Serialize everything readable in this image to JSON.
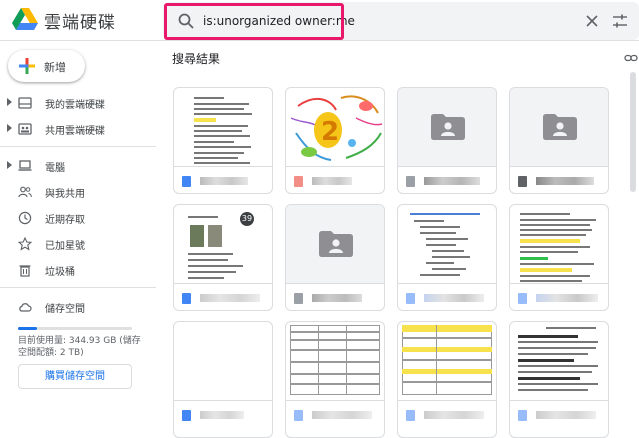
{
  "header": {
    "app_title": "雲端硬碟",
    "search_value": "is:unorganized owner:me",
    "highlight_color": "#e8196b"
  },
  "sidebar": {
    "new_label": "新增",
    "items": [
      {
        "label": "我的雲端硬碟",
        "icon": "drive-icon",
        "expandable": true
      },
      {
        "label": "共用雲端硬碟",
        "icon": "shared-drive-icon",
        "expandable": true
      },
      {
        "label": "電腦",
        "icon": "computer-icon",
        "expandable": true
      },
      {
        "label": "與我共用",
        "icon": "people-icon",
        "expandable": false
      },
      {
        "label": "近期存取",
        "icon": "clock-icon",
        "expandable": false
      },
      {
        "label": "已加星號",
        "icon": "star-icon",
        "expandable": false
      },
      {
        "label": "垃圾桶",
        "icon": "trash-icon",
        "expandable": false
      }
    ],
    "storage_label": "儲存空間",
    "storage_used_text": "目前使用量: 344.93 GB (儲存空間配額: 2 TB)",
    "storage_fraction": 0.17,
    "buy_storage_label": "購買儲存空間"
  },
  "main": {
    "results_title": "搜尋結果",
    "files": [
      {
        "type": "doc",
        "thumb": "doc-text"
      },
      {
        "type": "image",
        "thumb": "mindmap"
      },
      {
        "type": "folder",
        "thumb": "shared-folder"
      },
      {
        "type": "folder",
        "thumb": "shared-folder"
      },
      {
        "type": "doc",
        "thumb": "doc-photos",
        "badge": "39"
      },
      {
        "type": "folder",
        "thumb": "shared-folder"
      },
      {
        "type": "sheet",
        "thumb": "doc-outline"
      },
      {
        "type": "sheet",
        "thumb": "doc-highlight"
      },
      {
        "type": "doc",
        "thumb": "blank"
      },
      {
        "type": "doc",
        "thumb": "doc-table"
      },
      {
        "type": "doc",
        "thumb": "doc-yellow-table"
      },
      {
        "type": "doc",
        "thumb": "doc-headings"
      }
    ]
  },
  "colors": {
    "doc_blue": "#4285f4",
    "sheet_green": "#0f9d58",
    "image_red": "#ea4335",
    "folder_gray": "#5f6368",
    "accent": "#1a73e8"
  }
}
